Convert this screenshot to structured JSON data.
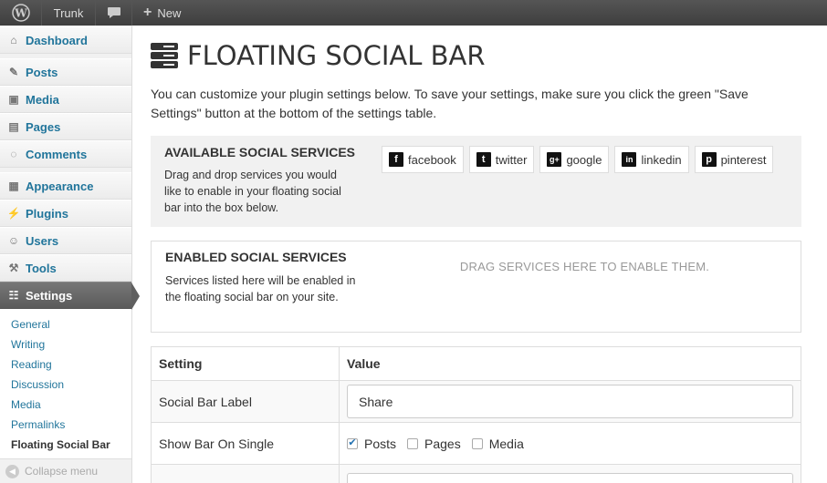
{
  "adminbar": {
    "site": "Trunk",
    "new_label": "New"
  },
  "sidebar": {
    "items": [
      {
        "label": "Dashboard",
        "icon": "dashboard-icon"
      },
      {
        "label": "Posts",
        "icon": "pin-icon"
      },
      {
        "label": "Media",
        "icon": "media-icon"
      },
      {
        "label": "Pages",
        "icon": "pages-icon"
      },
      {
        "label": "Comments",
        "icon": "comments-icon"
      },
      {
        "label": "Appearance",
        "icon": "appearance-icon"
      },
      {
        "label": "Plugins",
        "icon": "plugins-icon"
      },
      {
        "label": "Users",
        "icon": "users-icon"
      },
      {
        "label": "Tools",
        "icon": "tools-icon"
      },
      {
        "label": "Settings",
        "icon": "settings-icon"
      }
    ],
    "submenu": [
      "General",
      "Writing",
      "Reading",
      "Discussion",
      "Media",
      "Permalinks",
      "Floating Social Bar"
    ],
    "collapse": "Collapse menu"
  },
  "page": {
    "title": "FLOATING SOCIAL BAR",
    "intro": "You can customize your plugin settings below. To save your settings, make sure you click the green \"Save Settings\" button at the bottom of the settings table."
  },
  "available": {
    "heading": "AVAILABLE SOCIAL SERVICES",
    "desc": "Drag and drop services you would like to enable in your floating social bar into the box below.",
    "services": [
      {
        "label": "facebook",
        "icon": "facebook-icon",
        "glyph": "f"
      },
      {
        "label": "twitter",
        "icon": "twitter-icon",
        "glyph": "t"
      },
      {
        "label": "google",
        "icon": "google-plus-icon",
        "glyph": "g+"
      },
      {
        "label": "linkedin",
        "icon": "linkedin-icon",
        "glyph": "in"
      },
      {
        "label": "pinterest",
        "icon": "pinterest-icon",
        "glyph": "p"
      }
    ]
  },
  "enabled": {
    "heading": "ENABLED SOCIAL SERVICES",
    "desc": "Services listed here will be enabled in the floating social bar on your site.",
    "dropzone": "DRAG SERVICES HERE TO ENABLE THEM."
  },
  "settings": {
    "col_setting": "Setting",
    "col_value": "Value",
    "label_row": "Social Bar Label",
    "label_value": "Share",
    "show_row": "Show Bar On Single",
    "options": [
      {
        "label": "Posts",
        "checked": true
      },
      {
        "label": "Pages",
        "checked": false
      },
      {
        "label": "Media",
        "checked": false
      }
    ]
  }
}
